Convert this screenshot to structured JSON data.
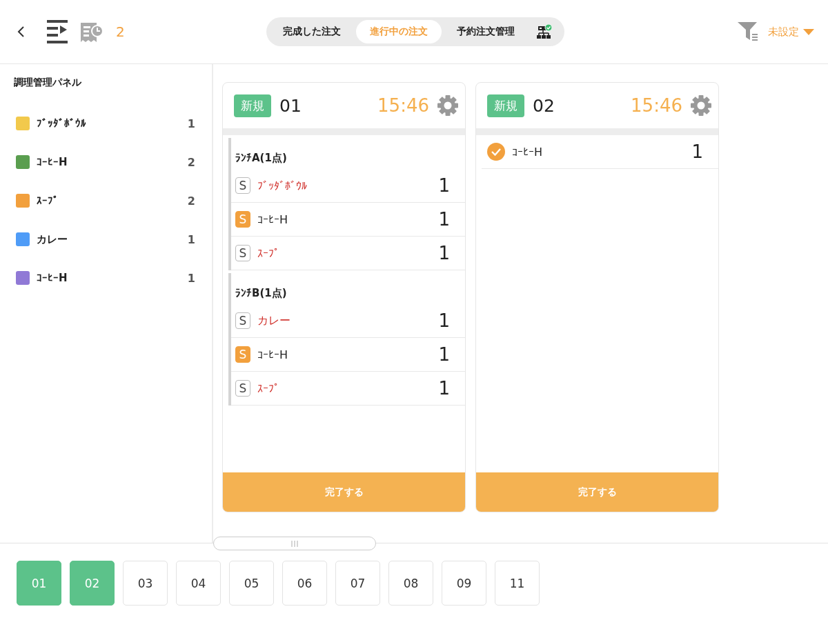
{
  "header": {
    "pending_count": "2",
    "tabs": [
      {
        "label": "完成した注文",
        "selected": false
      },
      {
        "label": "進行中の注文",
        "selected": true
      },
      {
        "label": "予約注文管理",
        "selected": false
      }
    ],
    "filter": {
      "label": "未設定"
    }
  },
  "sidebar": {
    "title": "調理管理パネル",
    "items": [
      {
        "name": "ﾌﾞｯﾀﾞﾎﾞｳﾙ",
        "count": "1",
        "color": "#f2c94c"
      },
      {
        "name": "ｺｰﾋｰH",
        "count": "2",
        "color": "#5a9e4f"
      },
      {
        "name": "ｽｰﾌﾟ",
        "count": "2",
        "color": "#f2a03d"
      },
      {
        "name": "カレー",
        "count": "1",
        "color": "#4f9cf7"
      },
      {
        "name": "ｺｰﾋｰH",
        "count": "1",
        "color": "#9079d6"
      }
    ]
  },
  "orders": [
    {
      "status": "新規",
      "number": "01",
      "time": "15:46",
      "action": "完了する",
      "entries": [
        {
          "kind": "group",
          "title": "ﾗﾝﾁA(1点)",
          "items": [
            {
              "kind": "set",
              "badge": "S",
              "badge_filled": false,
              "name": "ﾌﾞｯﾀﾞﾎﾞｳﾙ",
              "alert": true,
              "qty": "1"
            },
            {
              "kind": "set",
              "badge": "S",
              "badge_filled": true,
              "name": "ｺｰﾋｰH",
              "alert": false,
              "qty": "1"
            },
            {
              "kind": "set",
              "badge": "S",
              "badge_filled": false,
              "name": "ｽｰﾌﾟ",
              "alert": true,
              "qty": "1"
            }
          ]
        },
        {
          "kind": "group",
          "title": "ﾗﾝﾁB(1点)",
          "items": [
            {
              "kind": "set",
              "badge": "S",
              "badge_filled": false,
              "name": "カレー",
              "alert": true,
              "qty": "1"
            },
            {
              "kind": "set",
              "badge": "S",
              "badge_filled": true,
              "name": "ｺｰﾋｰH",
              "alert": false,
              "qty": "1"
            },
            {
              "kind": "set",
              "badge": "S",
              "badge_filled": false,
              "name": "ｽｰﾌﾟ",
              "alert": true,
              "qty": "1"
            }
          ]
        }
      ]
    },
    {
      "status": "新規",
      "number": "02",
      "time": "15:46",
      "action": "完了する",
      "entries": [
        {
          "kind": "item",
          "items": [
            {
              "kind": "checked",
              "name": "ｺｰﾋｰH",
              "alert": false,
              "qty": "1"
            }
          ]
        }
      ]
    }
  ],
  "tables": [
    {
      "label": "01",
      "selected": true
    },
    {
      "label": "02",
      "selected": true
    },
    {
      "label": "03",
      "selected": false
    },
    {
      "label": "04",
      "selected": false
    },
    {
      "label": "05",
      "selected": false
    },
    {
      "label": "06",
      "selected": false
    },
    {
      "label": "07",
      "selected": false
    },
    {
      "label": "08",
      "selected": false
    },
    {
      "label": "09",
      "selected": false
    },
    {
      "label": "11",
      "selected": false
    }
  ]
}
